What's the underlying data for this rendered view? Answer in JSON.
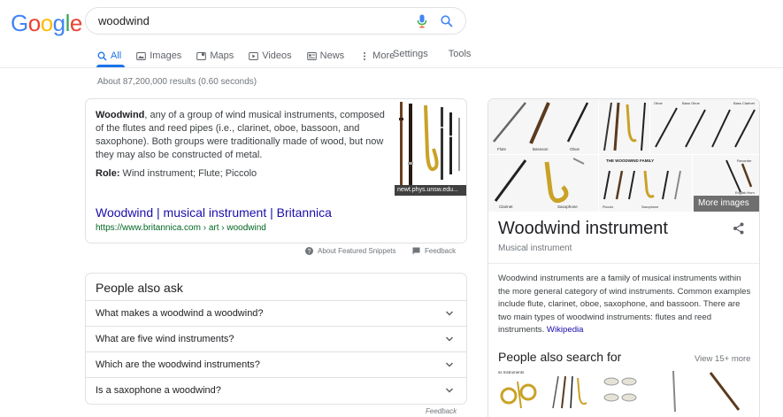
{
  "logo": {
    "letters": [
      {
        "ch": "G",
        "color": "#4285F4"
      },
      {
        "ch": "o",
        "color": "#EA4335"
      },
      {
        "ch": "o",
        "color": "#FBBC05"
      },
      {
        "ch": "g",
        "color": "#4285F4"
      },
      {
        "ch": "l",
        "color": "#34A853"
      },
      {
        "ch": "e",
        "color": "#EA4335"
      }
    ]
  },
  "search": {
    "query": "woodwind",
    "mic_icon": "mic-icon",
    "search_icon": "search-icon"
  },
  "tabs": [
    {
      "label": "All",
      "icon": "search-icon",
      "active": true
    },
    {
      "label": "Images",
      "icon": "image-icon"
    },
    {
      "label": "Maps",
      "icon": "map-icon"
    },
    {
      "label": "Videos",
      "icon": "video-icon"
    },
    {
      "label": "News",
      "icon": "news-icon"
    },
    {
      "label": "More",
      "icon": "more-vertical-icon"
    }
  ],
  "tools": {
    "settings": "Settings",
    "tools": "Tools"
  },
  "results_count": "About 87,200,000 results (0.60 seconds)",
  "snippet": {
    "term": "Woodwind",
    "text": ", any of a group of wind musical instruments, composed of the flutes and reed pipes (i.e., clarinet, oboe, bassoon, and saxophone). Both groups were traditionally made of wood, but now they may also be constructed of metal.",
    "role_label": "Role:",
    "role_value": " Wind instrument; Flute; Piccolo",
    "image_caption": "newt.phys.unsw.edu...",
    "link_title": "Woodwind | musical instrument | Britannica",
    "url": "https://www.britannica.com › art › woodwind"
  },
  "snippet_footer": {
    "about": "About Featured Snippets",
    "feedback": "Feedback"
  },
  "people_also_ask": {
    "heading": "People also ask",
    "questions": [
      "What makes a woodwind a woodwind?",
      "What are five wind instruments?",
      "Which are the woodwind instruments?",
      "Is a saxophone a woodwind?"
    ],
    "feedback": "Feedback"
  },
  "knowledge_panel": {
    "more_images": "More images",
    "title": "Woodwind instrument",
    "subtitle": "Musical instrument",
    "description": "Woodwind instruments are a family of musical instruments within the more general category of wind instruments. Common examples include flute, clarinet, oboe, saxophone, and bassoon. There are two main types of woodwind instruments: flutes and reed instruments. ",
    "source": "Wikipedia",
    "people_also_search": "People also search for",
    "view_more": "View 15+ more",
    "image_labels": {
      "flute": "Flute",
      "bassoon": "Bassoon",
      "oboe": "Oboe",
      "clarinet": "Clarinet",
      "saxophone": "Saxophone",
      "family": "THE WOODWIND FAMILY",
      "oboe2": "Oboe",
      "bassoon2": "Bassoon",
      "sax2": "Saxophone",
      "clarinet2": "Clarinet",
      "bass_clarinet": "Bass Clarinet",
      "alto_flute": "Alto Flute",
      "recorder": "Recorder",
      "english_horn": "English Horn",
      "bass_oboe": "Bass Oboe",
      "piccolo": "Piccolo",
      "thumb_caption": "ss Instruments"
    }
  },
  "colors": {
    "link": "#1a0dab",
    "url": "#006621",
    "accent": "#1a73e8",
    "border": "#dfe1e5"
  }
}
